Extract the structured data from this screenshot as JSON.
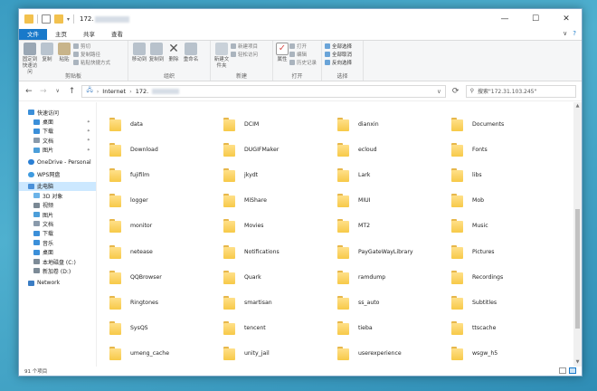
{
  "window": {
    "title": "172.",
    "controls": {
      "minimize": "—",
      "maximize": "☐",
      "close": "✕"
    }
  },
  "ribbon_tabs": [
    "文件",
    "主页",
    "共享",
    "查看"
  ],
  "ribbon_right": {
    "collapse": "∨",
    "help": "?"
  },
  "ribbon": {
    "clipboard": {
      "label": "剪贴板",
      "pin": "固定到快速访问",
      "copy": "复制",
      "paste": "粘贴",
      "cut": "剪切",
      "copy_path": "复制路径",
      "paste_shortcut": "粘贴快捷方式"
    },
    "organize": {
      "label": "组织",
      "move_to": "移动到",
      "copy_to": "复制到",
      "delete": "删除",
      "rename": "重命名"
    },
    "new": {
      "label": "新建",
      "new_folder": "新建文件夹",
      "new_item": "新建项目",
      "easy_access": "轻松访问"
    },
    "open": {
      "label": "打开",
      "properties": "属性",
      "open": "打开",
      "edit": "编辑",
      "history": "历史记录"
    },
    "select": {
      "label": "选择",
      "select_all": "全部选择",
      "select_none": "全部取消",
      "invert": "反向选择"
    }
  },
  "address": {
    "segment1": "Internet",
    "segment2": "172.",
    "search_placeholder": "搜索\"172.31.103.245\""
  },
  "nav": {
    "quick_access": "快速访问",
    "desktop": "桌面",
    "downloads": "下载",
    "documents": "文档",
    "pictures": "图片",
    "onedrive": "OneDrive - Personal",
    "wps": "WPS网盘",
    "this_pc": "此电脑",
    "objects3d": "3D 对象",
    "videos": "视频",
    "pictures2": "图片",
    "documents2": "文档",
    "downloads2": "下载",
    "music": "音乐",
    "desktop2": "桌面",
    "local_c": "本地磁盘 (C:)",
    "new_d": "新加卷 (D:)",
    "network": "Network"
  },
  "files": [
    "data",
    "DCIM",
    "dianxin",
    "Documents",
    "Download",
    "DUGIFMaker",
    "ecloud",
    "Fonts",
    "fujifilm",
    "jkydt",
    "Lark",
    "libs",
    "logger",
    "MiShare",
    "MIUI",
    "Mob",
    "monitor",
    "Movies",
    "MT2",
    "Music",
    "netease",
    "Notifications",
    "PayGateWayLibrary",
    "Pictures",
    "QQBrowser",
    "Quark",
    "ramdump",
    "Recordings",
    "Ringtones",
    "smartisan",
    "ss_auto",
    "Subtitles",
    "SysQS",
    "tencent",
    "tieba",
    "ttscache",
    "umeng_cache",
    "unity_jail",
    "userexperience",
    "wsgw_h5"
  ],
  "status": {
    "count": "91 个项目"
  },
  "colors": {
    "accent": "#1979ca",
    "folder": "#f7c948",
    "selection": "#cce8ff"
  }
}
